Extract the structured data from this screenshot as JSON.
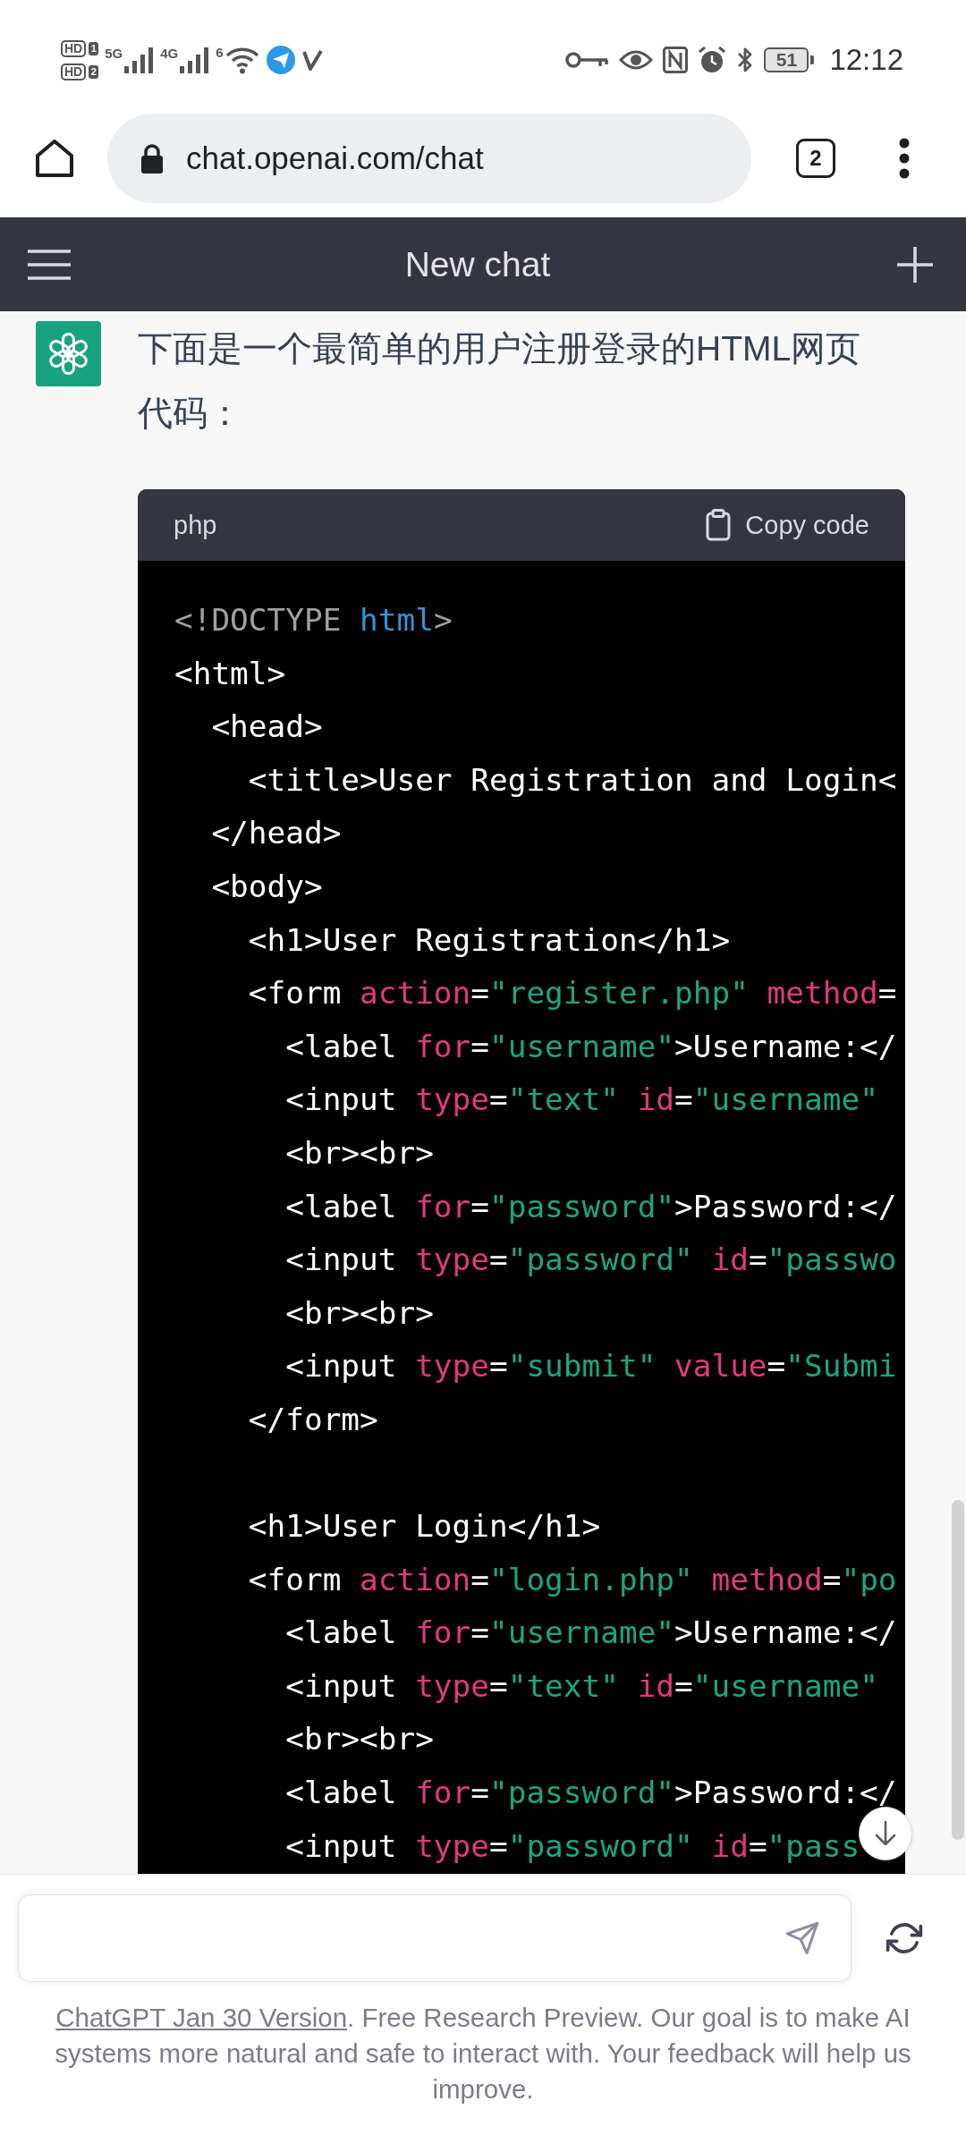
{
  "status_bar": {
    "sims": [
      {
        "label": "HD",
        "slot": "1"
      },
      {
        "label": "HD",
        "slot": "2"
      }
    ],
    "networks": [
      {
        "kind": "cellular",
        "label": "5G"
      },
      {
        "kind": "cellular",
        "label": "4G"
      },
      {
        "kind": "wifi",
        "label": "6"
      }
    ],
    "battery": "51",
    "time": "12:12"
  },
  "browser": {
    "url": "chat.openai.com/chat",
    "tab_count": "2"
  },
  "header": {
    "title": "New chat"
  },
  "message": {
    "text": "下面是一个最简单的用户注册登录的HTML网页代码：",
    "code_block": {
      "language": "php",
      "copy_label": "Copy code",
      "lines": [
        {
          "tokens": [
            {
              "kind": "meta",
              "text": "<!DOCTYPE "
            },
            {
              "kind": "keyword",
              "text": "html"
            },
            {
              "kind": "meta",
              "text": ">"
            }
          ]
        },
        {
          "tokens": [
            {
              "kind": "tag",
              "text": "<html>"
            }
          ],
          "children": [
            {
              "tokens": [
                {
                  "kind": "tag",
                  "text": "<head>"
                }
              ],
              "children": [
                {
                  "tokens": [
                    {
                      "kind": "tag",
                      "text": "<title>User Registration and Login<"
                    }
                  ]
                }
              ]
            },
            {
              "tokens": [
                {
                  "kind": "tag",
                  "text": "</head>"
                }
              ]
            },
            {
              "tokens": [
                {
                  "kind": "tag",
                  "text": "<body>"
                }
              ],
              "children": [
                {
                  "tokens": [
                    {
                      "kind": "tag",
                      "text": "<h1>User Registration</h1>"
                    }
                  ]
                },
                {
                  "tokens": [
                    {
                      "kind": "tag",
                      "text": "<form "
                    },
                    {
                      "kind": "attr",
                      "text": "action"
                    },
                    {
                      "kind": "tag",
                      "text": "="
                    },
                    {
                      "kind": "string",
                      "text": "\"register.php\""
                    },
                    {
                      "kind": "attr",
                      "text": " method"
                    },
                    {
                      "kind": "tag",
                      "text": "="
                    }
                  ],
                  "children": [
                    {
                      "tokens": [
                        {
                          "kind": "tag",
                          "text": "<label "
                        },
                        {
                          "kind": "attr",
                          "text": "for"
                        },
                        {
                          "kind": "tag",
                          "text": "="
                        },
                        {
                          "kind": "string",
                          "text": "\"username\""
                        },
                        {
                          "kind": "tag",
                          "text": ">Username:</"
                        }
                      ]
                    },
                    {
                      "tokens": [
                        {
                          "kind": "tag",
                          "text": "<input "
                        },
                        {
                          "kind": "attr",
                          "text": "type"
                        },
                        {
                          "kind": "tag",
                          "text": "="
                        },
                        {
                          "kind": "string",
                          "text": "\"text\""
                        },
                        {
                          "kind": "attr",
                          "text": " id"
                        },
                        {
                          "kind": "tag",
                          "text": "="
                        },
                        {
                          "kind": "string",
                          "text": "\"username\""
                        }
                      ]
                    },
                    {
                      "tokens": [
                        {
                          "kind": "tag",
                          "text": "<br><br>"
                        }
                      ]
                    },
                    {
                      "tokens": [
                        {
                          "kind": "tag",
                          "text": "<label "
                        },
                        {
                          "kind": "attr",
                          "text": "for"
                        },
                        {
                          "kind": "tag",
                          "text": "="
                        },
                        {
                          "kind": "string",
                          "text": "\"password\""
                        },
                        {
                          "kind": "tag",
                          "text": ">Password:</"
                        }
                      ]
                    },
                    {
                      "tokens": [
                        {
                          "kind": "tag",
                          "text": "<input "
                        },
                        {
                          "kind": "attr",
                          "text": "type"
                        },
                        {
                          "kind": "tag",
                          "text": "="
                        },
                        {
                          "kind": "string",
                          "text": "\"password\""
                        },
                        {
                          "kind": "attr",
                          "text": " id"
                        },
                        {
                          "kind": "tag",
                          "text": "="
                        },
                        {
                          "kind": "string",
                          "text": "\"passwo"
                        }
                      ]
                    },
                    {
                      "tokens": [
                        {
                          "kind": "tag",
                          "text": "<br><br>"
                        }
                      ]
                    },
                    {
                      "tokens": [
                        {
                          "kind": "tag",
                          "text": "<input "
                        },
                        {
                          "kind": "attr",
                          "text": "type"
                        },
                        {
                          "kind": "tag",
                          "text": "="
                        },
                        {
                          "kind": "string",
                          "text": "\"submit\""
                        },
                        {
                          "kind": "attr",
                          "text": " value"
                        },
                        {
                          "kind": "tag",
                          "text": "="
                        },
                        {
                          "kind": "string",
                          "text": "\"Submi"
                        }
                      ]
                    }
                  ]
                },
                {
                  "tokens": [
                    {
                      "kind": "tag",
                      "text": "</form>"
                    }
                  ]
                },
                {
                  "tokens": [
                    {
                      "kind": "tag",
                      "text": "<h1>User Login</h1>"
                    }
                  ],
                  "blank_line_before": true
                },
                {
                  "tokens": [
                    {
                      "kind": "tag",
                      "text": "<form "
                    },
                    {
                      "kind": "attr",
                      "text": "action"
                    },
                    {
                      "kind": "tag",
                      "text": "="
                    },
                    {
                      "kind": "string",
                      "text": "\"login.php\""
                    },
                    {
                      "kind": "attr",
                      "text": " method"
                    },
                    {
                      "kind": "tag",
                      "text": "="
                    },
                    {
                      "kind": "string",
                      "text": "\"po"
                    }
                  ],
                  "children": [
                    {
                      "tokens": [
                        {
                          "kind": "tag",
                          "text": "<label "
                        },
                        {
                          "kind": "attr",
                          "text": "for"
                        },
                        {
                          "kind": "tag",
                          "text": "="
                        },
                        {
                          "kind": "string",
                          "text": "\"username\""
                        },
                        {
                          "kind": "tag",
                          "text": ">Username:</"
                        }
                      ]
                    },
                    {
                      "tokens": [
                        {
                          "kind": "tag",
                          "text": "<input "
                        },
                        {
                          "kind": "attr",
                          "text": "type"
                        },
                        {
                          "kind": "tag",
                          "text": "="
                        },
                        {
                          "kind": "string",
                          "text": "\"text\""
                        },
                        {
                          "kind": "attr",
                          "text": " id"
                        },
                        {
                          "kind": "tag",
                          "text": "="
                        },
                        {
                          "kind": "string",
                          "text": "\"username\""
                        }
                      ]
                    },
                    {
                      "tokens": [
                        {
                          "kind": "tag",
                          "text": "<br><br>"
                        }
                      ]
                    },
                    {
                      "tokens": [
                        {
                          "kind": "tag",
                          "text": "<label "
                        },
                        {
                          "kind": "attr",
                          "text": "for"
                        },
                        {
                          "kind": "tag",
                          "text": "="
                        },
                        {
                          "kind": "string",
                          "text": "\"password\""
                        },
                        {
                          "kind": "tag",
                          "text": ">Password:</"
                        }
                      ]
                    },
                    {
                      "tokens": [
                        {
                          "kind": "tag",
                          "text": "<input "
                        },
                        {
                          "kind": "attr",
                          "text": "type"
                        },
                        {
                          "kind": "tag",
                          "text": "="
                        },
                        {
                          "kind": "string",
                          "text": "\"password\""
                        },
                        {
                          "kind": "attr",
                          "text": " id"
                        },
                        {
                          "kind": "tag",
                          "text": "="
                        },
                        {
                          "kind": "string",
                          "text": "\"pass"
                        }
                      ]
                    }
                  ]
                }
              ]
            }
          ]
        }
      ]
    }
  },
  "composer": {
    "footer_link": "ChatGPT Jan 30 Version",
    "footer_text": ". Free Research Preview. Our goal is to make AI systems more natural and safe to interact with. Your feedback will help us improve."
  }
}
